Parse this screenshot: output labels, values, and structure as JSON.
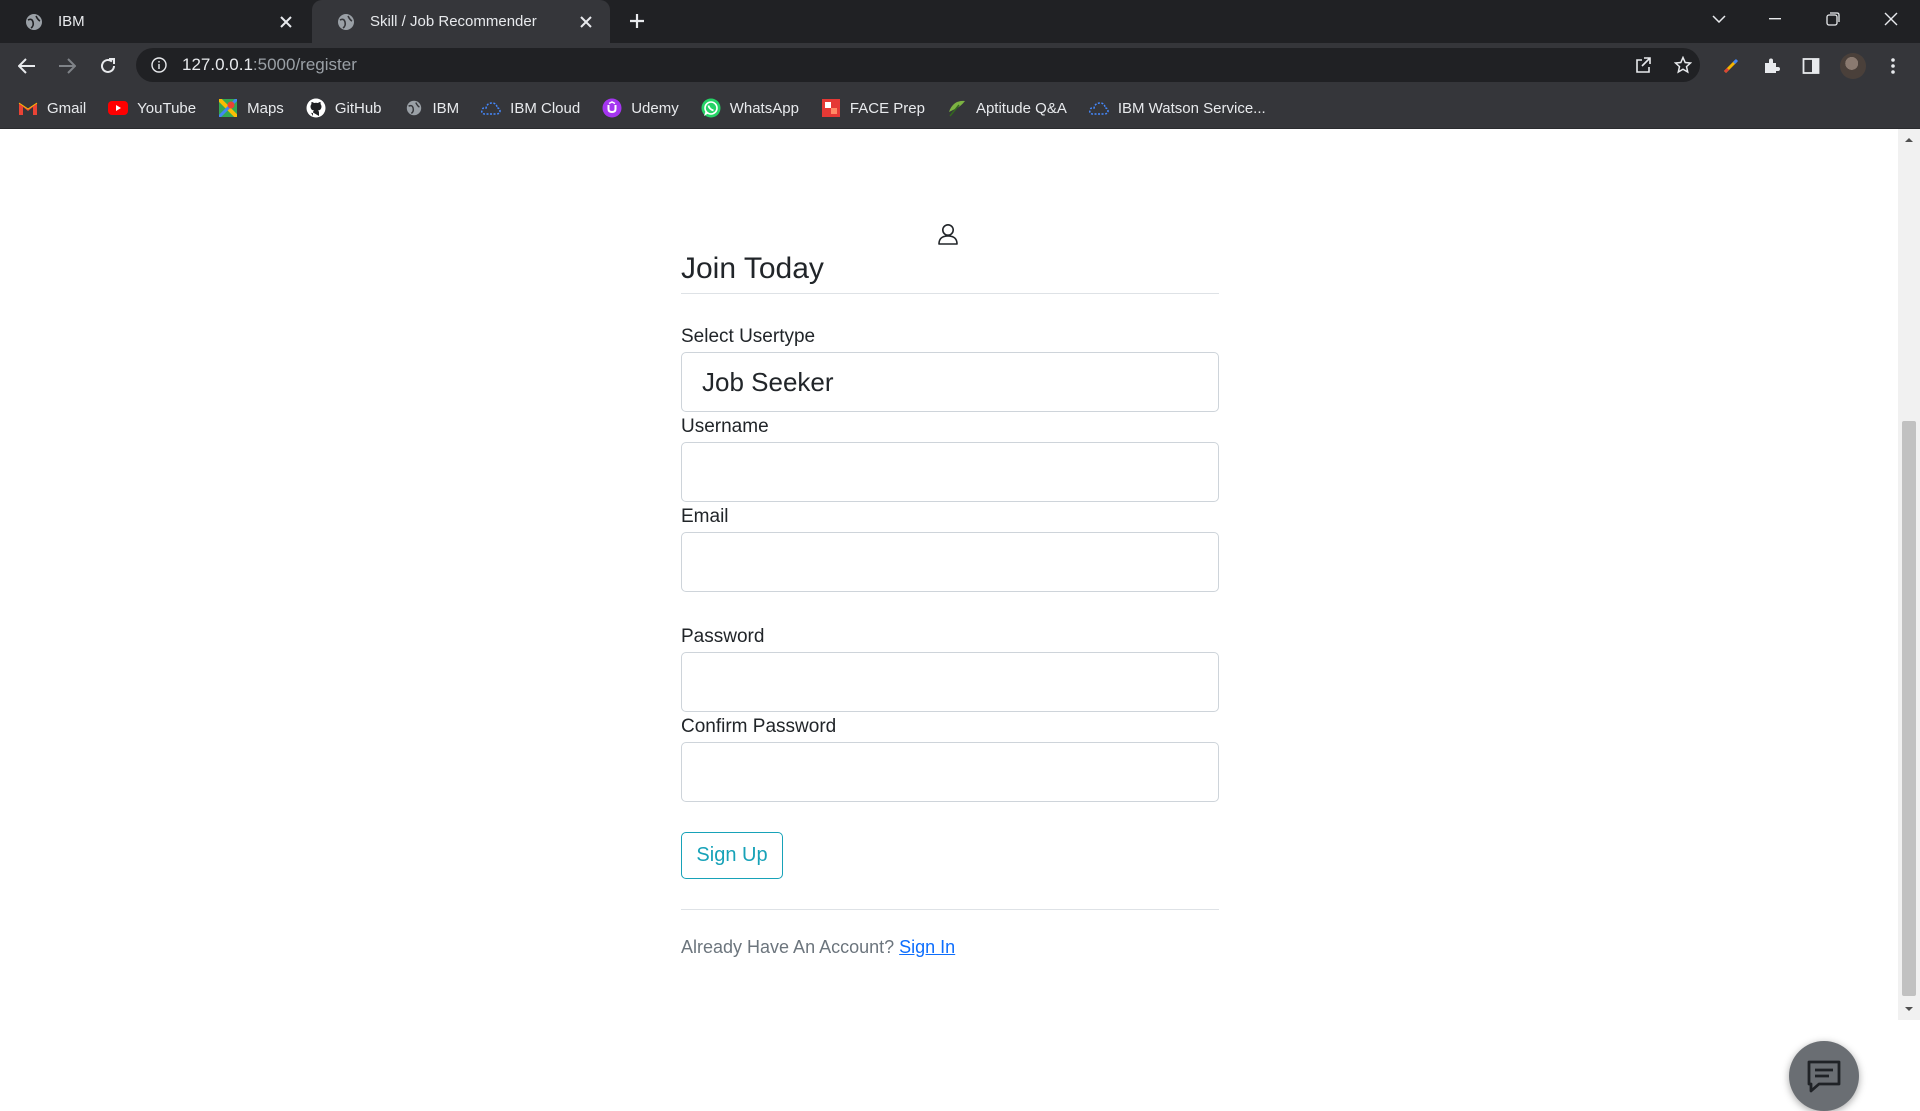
{
  "browser": {
    "tabs": [
      {
        "title": "IBM",
        "active": false
      },
      {
        "title": "Skill / Job Recommender",
        "active": true
      }
    ],
    "url_host": "127.0.0.1",
    "url_path": ":5000/register",
    "bookmarks": [
      {
        "label": "Gmail",
        "icon": "gmail-icon"
      },
      {
        "label": "YouTube",
        "icon": "youtube-icon"
      },
      {
        "label": "Maps",
        "icon": "maps-icon"
      },
      {
        "label": "GitHub",
        "icon": "github-icon"
      },
      {
        "label": "IBM",
        "icon": "globe-icon"
      },
      {
        "label": "IBM Cloud",
        "icon": "ibm-cloud-icon"
      },
      {
        "label": "Udemy",
        "icon": "udemy-icon"
      },
      {
        "label": "WhatsApp",
        "icon": "whatsapp-icon"
      },
      {
        "label": "FACE Prep",
        "icon": "faceprep-icon"
      },
      {
        "label": "Aptitude Q&A",
        "icon": "aptitude-icon"
      },
      {
        "label": "IBM Watson Service...",
        "icon": "ibm-cloud-icon"
      }
    ]
  },
  "form": {
    "legend": "Join Today",
    "usertype_label": "Select Usertype",
    "usertype_value": "Job Seeker",
    "username_label": "Username",
    "username_value": "",
    "email_label": "Email",
    "email_value": "",
    "password_label": "Password",
    "password_value": "",
    "confirm_label": "Confirm Password",
    "confirm_value": "",
    "submit_label": "Sign Up",
    "footer_text": "Already Have An Account?",
    "footer_link": "Sign In"
  },
  "colors": {
    "accent": "#17a2b8",
    "link": "#0d6efd",
    "chrome_dark": "#202124",
    "chrome_toolbar": "#35363a"
  }
}
